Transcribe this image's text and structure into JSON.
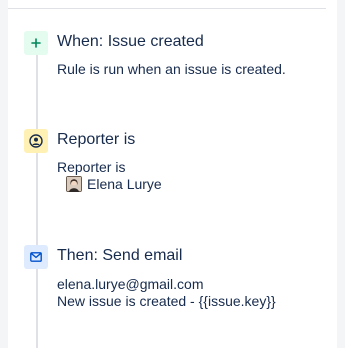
{
  "trigger": {
    "icon": "plus-icon",
    "title": "When: Issue created",
    "description": "Rule is run when an issue is created.",
    "icon_bg": "#e3fcef",
    "icon_color": "#00875a"
  },
  "condition": {
    "icon": "user-circle-icon",
    "title": "Reporter is",
    "label": "Reporter is",
    "user": "Elena Lurye",
    "icon_bg": "#fff0b3",
    "icon_color": "#172b4d"
  },
  "action": {
    "icon": "envelope-icon",
    "title": "Then: Send email",
    "to": "elena.lurye@gmail.com",
    "subject": "New issue is created - {{issue.key}}",
    "icon_bg": "#deebff",
    "icon_color": "#0052cc"
  }
}
